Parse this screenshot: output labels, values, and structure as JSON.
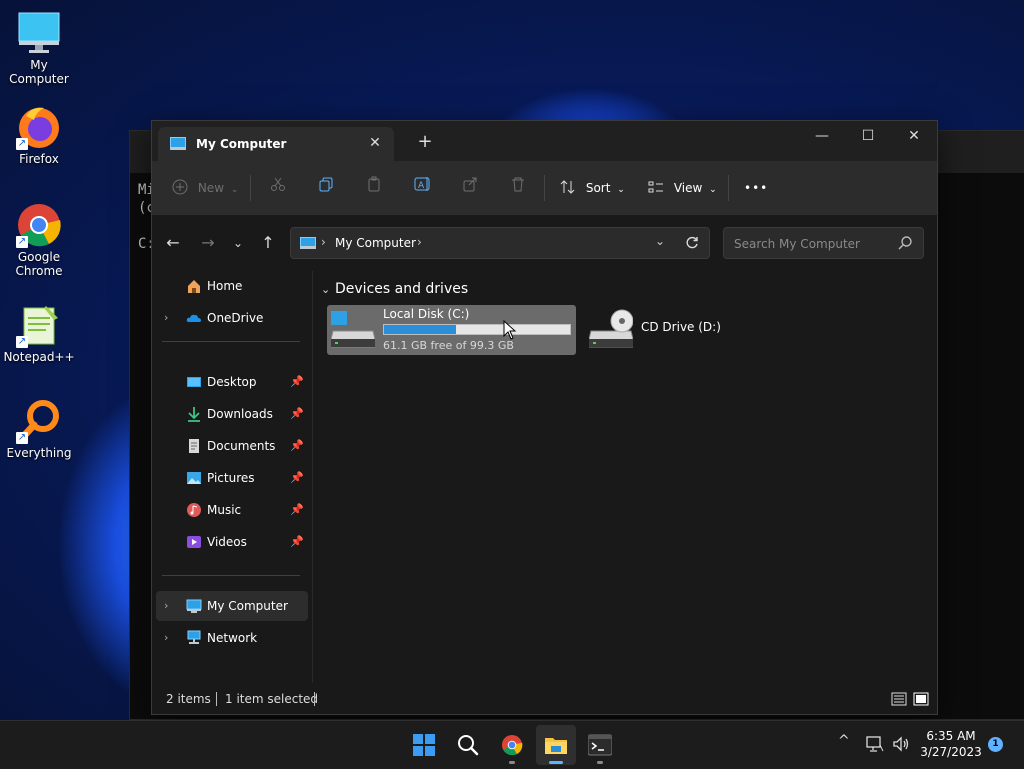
{
  "desktop": {
    "icons": [
      {
        "label": "My Computer",
        "icon": "computer-icon"
      },
      {
        "label": "Firefox",
        "icon": "firefox-icon"
      },
      {
        "label": "Google Chrome",
        "icon": "chrome-icon"
      },
      {
        "label": "Notepad++",
        "icon": "notepadpp-icon"
      },
      {
        "label": "Everything",
        "icon": "everything-icon"
      }
    ]
  },
  "background_terminal": {
    "lines": [
      "Mi",
      "(c",
      "",
      "C:"
    ]
  },
  "explorer": {
    "tab": {
      "title": "My Computer",
      "close": "✕"
    },
    "new_tab": "+",
    "window_controls": {
      "minimize": "—",
      "maximize": "☐",
      "close": "✕"
    },
    "toolbar": {
      "new_label": "New",
      "sort_label": "Sort",
      "view_label": "View",
      "more_label": "•••"
    },
    "address": {
      "path": "My Computer"
    },
    "search": {
      "placeholder": "Search My Computer"
    },
    "sidebar": {
      "home": "Home",
      "onedrive": "OneDrive",
      "quick_access": [
        {
          "label": "Desktop",
          "icon": "desktop-folder-icon"
        },
        {
          "label": "Downloads",
          "icon": "downloads-icon"
        },
        {
          "label": "Documents",
          "icon": "documents-icon"
        },
        {
          "label": "Pictures",
          "icon": "pictures-icon"
        },
        {
          "label": "Music",
          "icon": "music-icon"
        },
        {
          "label": "Videos",
          "icon": "videos-icon"
        }
      ],
      "my_computer": "My Computer",
      "network": "Network"
    },
    "content": {
      "group_title": "Devices and drives",
      "drives": [
        {
          "name": "Local Disk (C:)",
          "free_text": "61.1 GB free of 99.3 GB",
          "used_fraction": 0.385,
          "selected": true
        },
        {
          "name": "CD Drive (D:)",
          "selected": false
        }
      ]
    },
    "status": {
      "items": "2 items",
      "selection": "1 item selected"
    }
  },
  "taskbar": {
    "apps": [
      "start-icon",
      "search-icon",
      "chrome-icon",
      "file-explorer-icon",
      "terminal-icon"
    ],
    "tray_chevron": "^",
    "time": "6:35 AM",
    "date": "3/27/2023",
    "notification_count": "1"
  },
  "colors": {
    "accent": "#5fb2ff",
    "drive_bar": "#2a8fd8",
    "window_bg": "#191919",
    "toolbar_bg": "#2c2c2c"
  }
}
